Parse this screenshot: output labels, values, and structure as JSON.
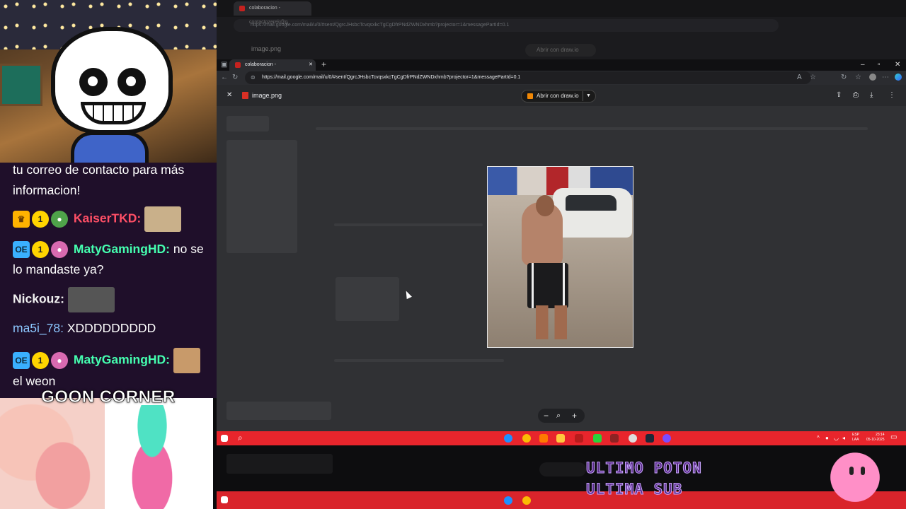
{
  "chat": {
    "msg0": {
      "text": "tu correo de contacto para más informacion!"
    },
    "msg1": {
      "user": "KaiserTKD:"
    },
    "msg2": {
      "user": "MatyGamingHD:",
      "text": "no se lo mandaste ya?"
    },
    "msg3": {
      "user": "Nickouz:"
    },
    "msg4": {
      "user": "ma5i_78:",
      "text": "XDDDDDDDDD"
    },
    "msg5": {
      "user": "MatyGamingHD:",
      "text": "el weon"
    },
    "badges": {
      "one": "1",
      "oe": "OE"
    }
  },
  "overlay": {
    "goon_title": "GOON CORNER",
    "promo_line1": "ULTIMO POTON",
    "promo_line2": "ULTIMA SUB"
  },
  "browser": {
    "tab_title": "colaboracion - contactozerek@g",
    "new_tab": "+",
    "url": "https://mail.google.com/mail/u/0/#sent/QgrcJHsbcTcvqsxkcTgCgDfrPNdZWNDxhmb?projector=1&messagePartId=0.1",
    "controls": {
      "minimize": "–",
      "maximize": "▫",
      "close": "✕"
    }
  },
  "viewer": {
    "close": "✕",
    "file_name": "image.png",
    "open_with": "Abrir con draw.io",
    "zoom_out": "−",
    "zoom_fit": "⌕",
    "zoom_in": "+"
  },
  "taskbar": {
    "lang": "ESP",
    "lang2": "LAA",
    "time": "23:14",
    "date": "05-10-2025"
  },
  "colors": {
    "taskbar": "#e8252c",
    "chat_bg": "#1f0f2a",
    "accent_green": "#45ffb0",
    "accent_red": "#ff4f66"
  }
}
